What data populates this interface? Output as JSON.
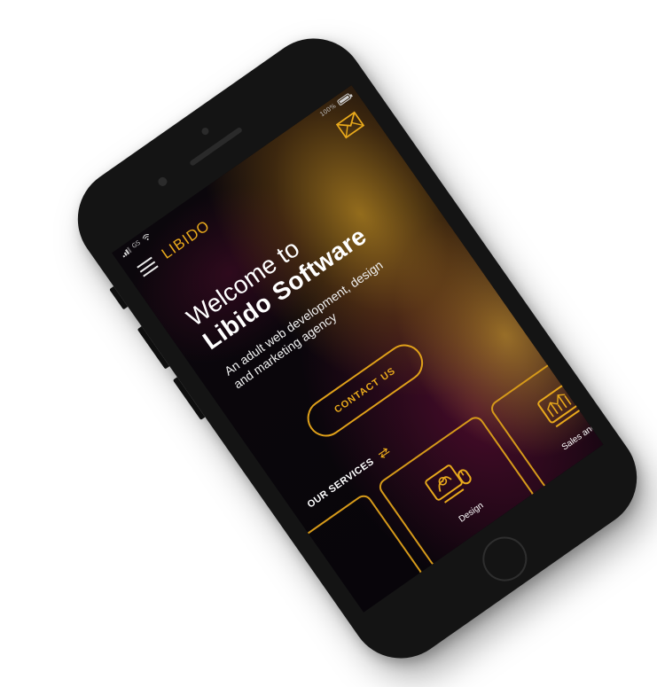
{
  "status_bar": {
    "carrier": "GS",
    "battery": "100%",
    "battery_level": 1.0
  },
  "header": {
    "logo": "LIBIDO",
    "menu_icon": "hamburger-menu-icon",
    "mail_icon": "mail-icon"
  },
  "hero": {
    "welcome": "Welcome to",
    "title": "Libido Software",
    "subtitle": "An adult web development, design and marketing agency",
    "cta_label": "CONTACT US"
  },
  "services": {
    "title": "OUR SERVICES",
    "arrows_icon": "swap-arrows-icon",
    "items": [
      {
        "label": "",
        "icon": ""
      },
      {
        "label": "Design",
        "icon": "design-monitor-mouse-icon"
      },
      {
        "label": "Sales and M",
        "icon": "sales-chart-icon"
      }
    ]
  },
  "colors": {
    "accent": "#e8a91c",
    "background": "#07050a",
    "device": "#141414",
    "text": "#ffffff"
  }
}
